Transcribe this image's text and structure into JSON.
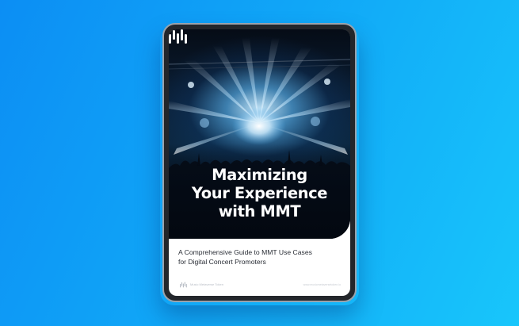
{
  "cover": {
    "title_lines": [
      "Maximizing",
      "Your Experience",
      "with MMT"
    ],
    "subtitle_lines": [
      "A Comprehensive Guide to MMT Use Cases",
      "for Digital Concert Promoters"
    ],
    "footer_left": "Music Metaverse Token",
    "footer_right": "www.musicmetaversetoken.io",
    "logo_icon": "mmt-logo-icon"
  },
  "colors": {
    "background_start": "#0c8ef4",
    "background_end": "#18c6fb",
    "device_frame": "#23262b",
    "title_text": "#ffffff",
    "subtitle_text": "#2a2e36"
  }
}
